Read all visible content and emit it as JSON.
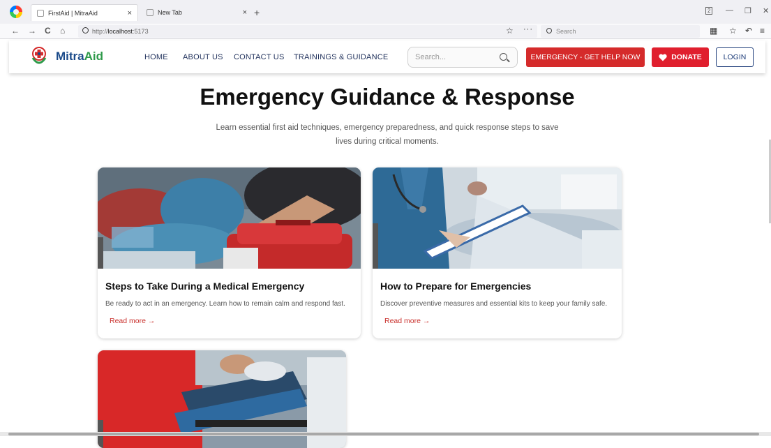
{
  "browser": {
    "tabs": [
      {
        "title": "FirstAid | MitraAid",
        "close": "×"
      },
      {
        "title": "New Tab",
        "close": "×"
      }
    ],
    "new_tab": "+",
    "url_scheme": "http://",
    "url_host": "localhost",
    "url_port": ":5173",
    "search_placeholder": "Search",
    "tab_count": "2"
  },
  "header": {
    "logo_mitra": "Mitra",
    "logo_aid": "Aid",
    "menu": [
      "HOME",
      "ABOUT US",
      "CONTACT US",
      "TRAININGS & GUIDANCE"
    ],
    "search_placeholder": "Search...",
    "emergency_label": "EMERGENCY - GET HELP NOW",
    "donate_label": "DONATE",
    "login_label": "LOGIN",
    "colors": {
      "brand_blue": "#1a4a8a",
      "brand_green": "#2e9a4a",
      "emergency_red": "#d52b2b"
    }
  },
  "hero": {
    "title": "Emergency Guidance & Response",
    "subtitle": "Learn essential first aid techniques, emergency preparedness, and quick response steps to save lives during critical moments."
  },
  "cards": [
    {
      "title": "Steps to Take During a Medical Emergency",
      "description": "Be ready to act in an emergency. Learn how to remain calm and respond fast.",
      "link": "Read more →",
      "image": "first-aid-kit-photo"
    },
    {
      "title": "How to Prepare for Emergencies",
      "description": "Discover preventive measures and essential kits to keep your family safe.",
      "link": "Read more →",
      "image": "doctor-clipboard-photo"
    },
    {
      "title": "",
      "description": "",
      "link": "",
      "image": "stretcher-rescue-photo"
    }
  ]
}
